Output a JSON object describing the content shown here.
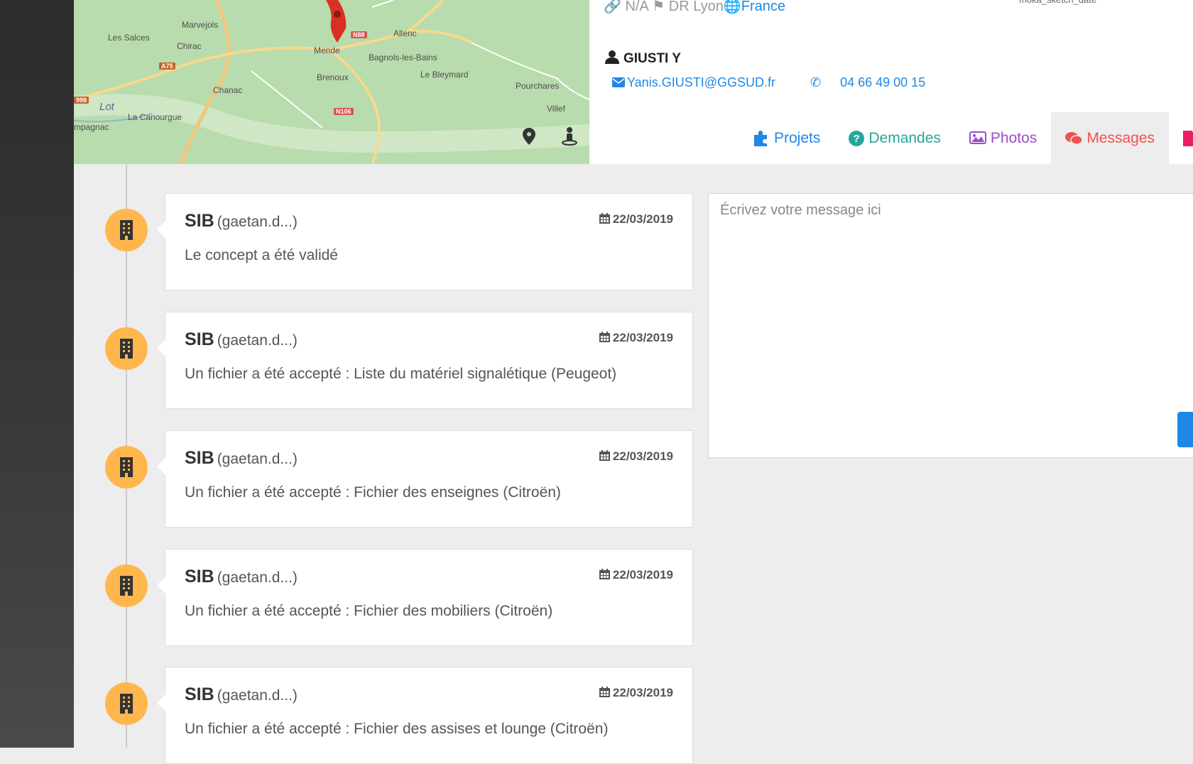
{
  "map": {
    "labels": {
      "marvejols": "Marvejols",
      "les_salces": "Les Salces",
      "chirac": "Chirac",
      "mende": "Mende",
      "allenc": "Allenc",
      "bagnols": "Bagnols-les-Bains",
      "brenoux": "Brenoux",
      "le_bleymard": "Le Bleymard",
      "chanac": "Chanac",
      "pourcharesses": "Pourchares",
      "villefort": "Villef",
      "lot": "Lot",
      "la_canourgue": "La Canourgue",
      "campagnac": "mpagnac",
      "a75": "A75",
      "n88": "N88",
      "n106": "N106",
      "d998": "998"
    }
  },
  "header": {
    "meta": {
      "na": "N/A",
      "dr": "DR Lyon",
      "country": "France"
    },
    "sketch_date_label": "moka_sketch_date",
    "contact": {
      "name": "GIUSTI Y",
      "email": "Yanis.GIUSTI@GGSUD.fr",
      "phone": "04 66 49 00 15"
    },
    "tabs": {
      "projets": "Projets",
      "demandes": "Demandes",
      "photos": "Photos",
      "messages": "Messages"
    }
  },
  "timeline": [
    {
      "author": "SIB",
      "user": "(gaetan.d...)",
      "date": "22/03/2019",
      "text": "Le concept a été validé"
    },
    {
      "author": "SIB",
      "user": "(gaetan.d...)",
      "date": "22/03/2019",
      "text": "Un fichier a été accepté : Liste du matériel signalétique (Peugeot)"
    },
    {
      "author": "SIB",
      "user": "(gaetan.d...)",
      "date": "22/03/2019",
      "text": "Un fichier a été accepté : Fichier des enseignes (Citroën)"
    },
    {
      "author": "SIB",
      "user": "(gaetan.d...)",
      "date": "22/03/2019",
      "text": "Un fichier a été accepté : Fichier des mobiliers (Citroën)"
    },
    {
      "author": "SIB",
      "user": "(gaetan.d...)",
      "date": "22/03/2019",
      "text": "Un fichier a été accepté : Fichier des assises et lounge (Citroën)"
    }
  ],
  "message_form": {
    "placeholder": "Écrivez votre message ici"
  },
  "colors": {
    "accent_blue": "#1e88e5",
    "timeline_icon": "#ffb74d",
    "messages_tab": "#ef5350"
  }
}
